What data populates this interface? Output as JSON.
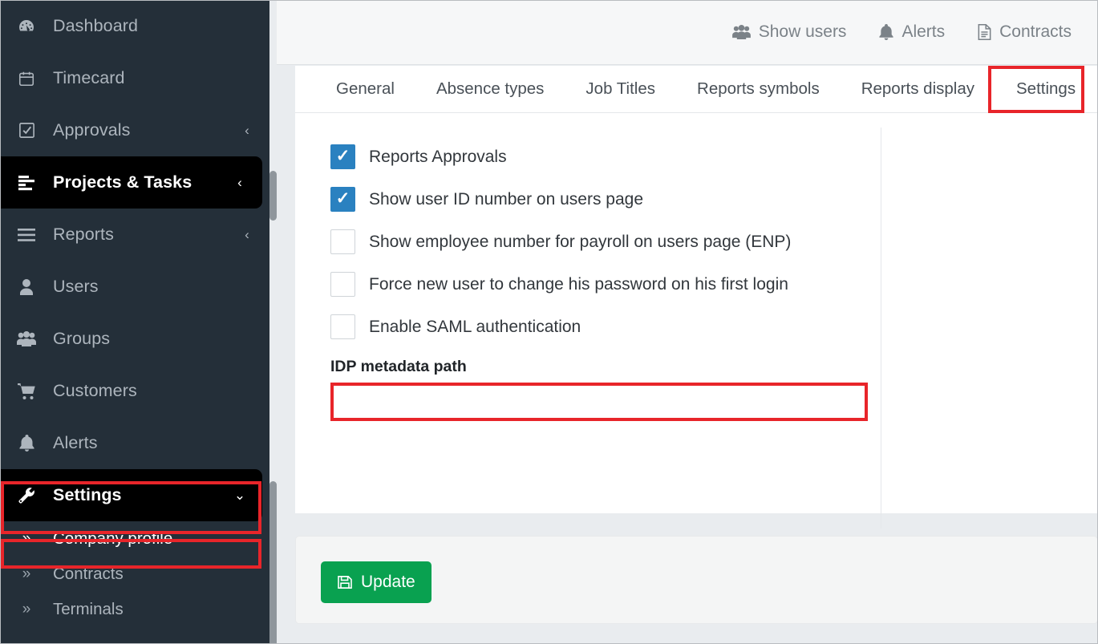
{
  "sidebar": {
    "items": [
      {
        "label": "Dashboard",
        "icon": "dashboard-icon",
        "caret": "",
        "state": "normal"
      },
      {
        "label": "Timecard",
        "icon": "calendar-icon",
        "caret": "",
        "state": "normal"
      },
      {
        "label": "Approvals",
        "icon": "check-square-icon",
        "caret": "‹",
        "state": "normal"
      },
      {
        "label": "Projects & Tasks",
        "icon": "tasks-icon",
        "caret": "‹",
        "state": "active"
      },
      {
        "label": "Reports",
        "icon": "bars-icon",
        "caret": "‹",
        "state": "normal"
      },
      {
        "label": "Users",
        "icon": "user-icon",
        "caret": "",
        "state": "normal"
      },
      {
        "label": "Groups",
        "icon": "users-icon",
        "caret": "",
        "state": "normal"
      },
      {
        "label": "Customers",
        "icon": "cart-icon",
        "caret": "",
        "state": "normal"
      },
      {
        "label": "Alerts",
        "icon": "bell-icon",
        "caret": "",
        "state": "normal"
      },
      {
        "label": "Settings",
        "icon": "wrench-icon",
        "caret": "⌄",
        "state": "active-expanded"
      }
    ],
    "subitems": [
      {
        "label": "Company profile",
        "icon": "double-chevron-icon",
        "state": "current"
      },
      {
        "label": "Contracts",
        "icon": "double-chevron-icon",
        "state": "normal"
      },
      {
        "label": "Terminals",
        "icon": "double-chevron-icon",
        "state": "normal"
      }
    ]
  },
  "topbar": {
    "links": [
      {
        "label": "Show users",
        "icon": "users-icon"
      },
      {
        "label": "Alerts",
        "icon": "bell-icon"
      },
      {
        "label": "Contracts",
        "icon": "file-icon"
      }
    ]
  },
  "tabs": [
    {
      "label": "General",
      "active": false
    },
    {
      "label": "Absence types",
      "active": false
    },
    {
      "label": "Job Titles",
      "active": false
    },
    {
      "label": "Reports symbols",
      "active": false
    },
    {
      "label": "Reports display",
      "active": false
    },
    {
      "label": "Settings",
      "active": true
    }
  ],
  "form": {
    "checkboxes": [
      {
        "label": "Reports Approvals",
        "checked": true
      },
      {
        "label": "Show user ID number on users page",
        "checked": true
      },
      {
        "label": "Show employee number for payroll on users page (ENP)",
        "checked": false
      },
      {
        "label": "Force new user to change his password on his first login",
        "checked": false
      },
      {
        "label": "Enable SAML authentication",
        "checked": false
      }
    ],
    "idp": {
      "label": "IDP metadata path",
      "value": "",
      "placeholder": ""
    }
  },
  "footer": {
    "update_label": "Update",
    "update_icon": "save-icon"
  },
  "colors": {
    "sidebar_bg": "#242f39",
    "sidebar_active_bg": "#000000",
    "checkbox_checked": "#2a81c0",
    "update_button": "#09a150",
    "annotation_red": "#e8252a",
    "page_bg": "#e9ecef"
  }
}
